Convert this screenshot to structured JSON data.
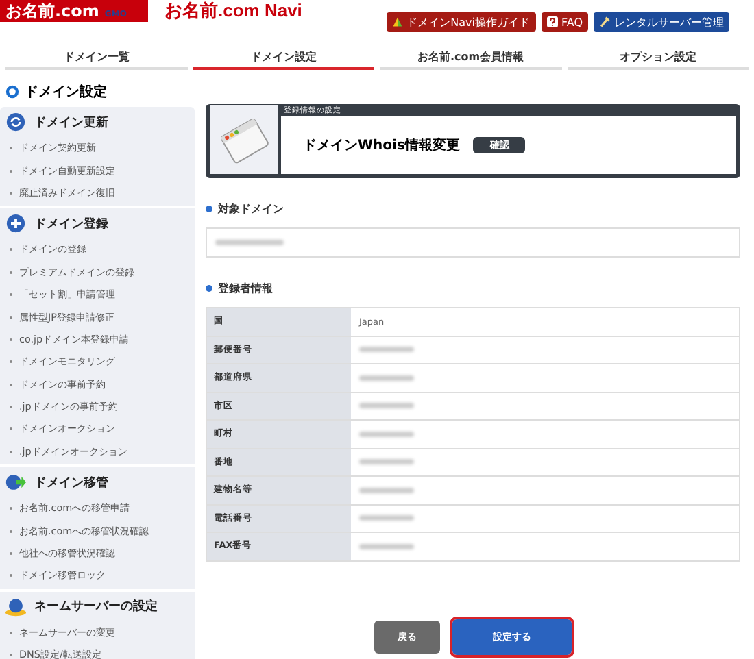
{
  "header": {
    "logo": {
      "text": "お名前.com",
      "sub": "GMO"
    },
    "title": "お名前.com Navi",
    "links": [
      {
        "label": "ドメインNavi操作ガイド",
        "kind": "guide"
      },
      {
        "label": "FAQ",
        "kind": "faq"
      },
      {
        "label": "レンタルサーバー管理",
        "kind": "server"
      }
    ]
  },
  "tabs": [
    {
      "label": "ドメイン一覧",
      "selected": false
    },
    {
      "label": "ドメイン設定",
      "selected": true
    },
    {
      "label": "お名前.com会員情報",
      "selected": false
    },
    {
      "label": "オプション設定",
      "selected": false
    }
  ],
  "sidebar": {
    "title": "ドメイン設定",
    "sections": [
      {
        "title": "ドメイン更新",
        "items": [
          "ドメイン契約更新",
          "ドメイン自動更新設定",
          "廃止済みドメイン復旧"
        ]
      },
      {
        "title": "ドメイン登録",
        "items": [
          "ドメインの登録",
          "プレミアムドメインの登録",
          "「セット割」申請管理",
          "属性型JP登録申請修正",
          "co.jpドメイン本登録申請",
          "ドメインモニタリング",
          "ドメインの事前予約",
          ".jpドメインの事前予約",
          "ドメインオークション",
          ".jpドメインオークション"
        ]
      },
      {
        "title": "ドメイン移管",
        "items": [
          "お名前.comへの移管申請",
          "お名前.comへの移管状況確認",
          "他社への移管状況確認",
          "ドメイン移管ロック"
        ]
      },
      {
        "title": "ネームサーバーの設定",
        "items": [
          "ネームサーバーの変更",
          "DNS設定/転送設定"
        ]
      }
    ]
  },
  "panel": {
    "caption": "登録情報の設定",
    "title": "ドメインWhois情報変更",
    "step": "確認"
  },
  "target_domain": {
    "heading": "対象ドメイン"
  },
  "registrant": {
    "heading": "登録者情報",
    "rows": [
      {
        "label": "国",
        "value": "Japan"
      },
      {
        "label": "郵便番号"
      },
      {
        "label": "都道府県"
      },
      {
        "label": "市区"
      },
      {
        "label": "町村"
      },
      {
        "label": "番地"
      },
      {
        "label": "建物名等"
      },
      {
        "label": "電話番号"
      },
      {
        "label": "FAX番号"
      }
    ]
  },
  "buttons": [
    {
      "label": "戻る",
      "kind": "back"
    },
    {
      "label": "設定する",
      "kind": "submit"
    }
  ]
}
